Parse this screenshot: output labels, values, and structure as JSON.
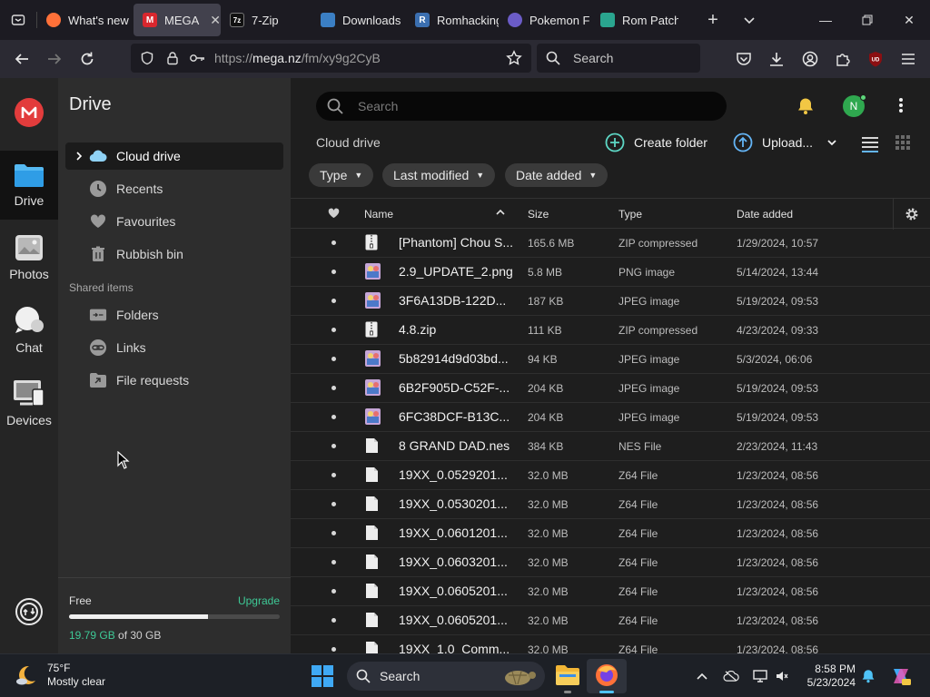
{
  "browser": {
    "tabs": [
      {
        "label": "What's new",
        "icon": "firefox-icon",
        "color": "#ff7139"
      },
      {
        "label": "MEGA",
        "icon": "mega-icon",
        "color": "#d9272e"
      },
      {
        "label": "7-Zip",
        "icon": "7zip-icon",
        "color": "#2b2a33"
      },
      {
        "label": "Downloads",
        "icon": "downloads-site-icon",
        "color": "#3b7fc4"
      },
      {
        "label": "Romhacking",
        "icon": "romhacking-icon",
        "color": "#3b6fb0"
      },
      {
        "label": "Pokemon F",
        "icon": "pokemon-icon",
        "color": "#6b5cc7"
      },
      {
        "label": "Rom Patch",
        "icon": "rompatch-icon",
        "color": "#2aa58f"
      }
    ],
    "url_prefix": "https://",
    "url_host": "mega.nz",
    "url_path": "/fm/xy9g2CyB",
    "search_placeholder": "Search"
  },
  "rail": {
    "items": [
      {
        "label": "Drive"
      },
      {
        "label": "Photos"
      },
      {
        "label": "Chat"
      },
      {
        "label": "Devices"
      }
    ]
  },
  "side": {
    "title": "Drive",
    "nav": [
      {
        "label": "Cloud drive"
      },
      {
        "label": "Recents"
      },
      {
        "label": "Favourites"
      },
      {
        "label": "Rubbish bin"
      }
    ],
    "shared_heading": "Shared items",
    "shared": [
      {
        "label": "Folders"
      },
      {
        "label": "Links"
      },
      {
        "label": "File requests"
      }
    ],
    "storage": {
      "plan": "Free",
      "upgrade": "Upgrade",
      "used": "19.79 GB",
      "of_total": " of 30 GB",
      "fraction": 0.66
    }
  },
  "main": {
    "search_placeholder": "Search",
    "avatar_letter": "N",
    "breadcrumb": "Cloud drive",
    "create_folder": "Create folder",
    "upload": "Upload...",
    "filters": [
      "Type",
      "Last modified",
      "Date added"
    ],
    "columns": {
      "name": "Name",
      "size": "Size",
      "type": "Type",
      "date": "Date added"
    },
    "files": [
      {
        "name": "[Phantom] Chou S...",
        "size": "165.6 MB",
        "type": "ZIP compressed",
        "date": "1/29/2024, 10:57",
        "thumb": "zip"
      },
      {
        "name": "2.9_UPDATE_2.png",
        "size": "5.8 MB",
        "type": "PNG image",
        "date": "5/14/2024, 13:44",
        "thumb": "img"
      },
      {
        "name": "3F6A13DB-122D...",
        "size": "187 KB",
        "type": "JPEG image",
        "date": "5/19/2024, 09:53",
        "thumb": "img"
      },
      {
        "name": "4.8.zip",
        "size": "111 KB",
        "type": "ZIP compressed",
        "date": "4/23/2024, 09:33",
        "thumb": "zip"
      },
      {
        "name": "5b82914d9d03bd...",
        "size": "94 KB",
        "type": "JPEG image",
        "date": "5/3/2024, 06:06",
        "thumb": "img"
      },
      {
        "name": "6B2F905D-C52F-...",
        "size": "204 KB",
        "type": "JPEG image",
        "date": "5/19/2024, 09:53",
        "thumb": "img"
      },
      {
        "name": "6FC38DCF-B13C...",
        "size": "204 KB",
        "type": "JPEG image",
        "date": "5/19/2024, 09:53",
        "thumb": "img"
      },
      {
        "name": "8 GRAND DAD.nes",
        "size": "384 KB",
        "type": "NES File",
        "date": "2/23/2024, 11:43",
        "thumb": "file"
      },
      {
        "name": "19XX_0.0529201...",
        "size": "32.0 MB",
        "type": "Z64 File",
        "date": "1/23/2024, 08:56",
        "thumb": "file"
      },
      {
        "name": "19XX_0.0530201...",
        "size": "32.0 MB",
        "type": "Z64 File",
        "date": "1/23/2024, 08:56",
        "thumb": "file"
      },
      {
        "name": "19XX_0.0601201...",
        "size": "32.0 MB",
        "type": "Z64 File",
        "date": "1/23/2024, 08:56",
        "thumb": "file"
      },
      {
        "name": "19XX_0.0603201...",
        "size": "32.0 MB",
        "type": "Z64 File",
        "date": "1/23/2024, 08:56",
        "thumb": "file"
      },
      {
        "name": "19XX_0.0605201...",
        "size": "32.0 MB",
        "type": "Z64 File",
        "date": "1/23/2024, 08:56",
        "thumb": "file"
      },
      {
        "name": "19XX_0.0605201...",
        "size": "32.0 MB",
        "type": "Z64 File",
        "date": "1/23/2024, 08:56",
        "thumb": "file"
      },
      {
        "name": "19XX_1.0_Comm...",
        "size": "32.0 MB",
        "type": "Z64 File",
        "date": "1/23/2024, 08:56",
        "thumb": "file"
      }
    ]
  },
  "taskbar": {
    "temp": "75°F",
    "condition": "Mostly clear",
    "search": "Search",
    "time": "8:58 PM",
    "date": "5/23/2024"
  },
  "colors": {
    "mega_red": "#e23c3c",
    "accent_green": "#3ec996",
    "teal": "#5dd7c5"
  }
}
